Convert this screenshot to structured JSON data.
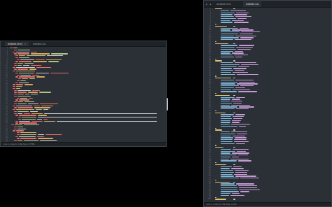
{
  "left_window": {
    "tabs": [
      {
        "label": "website.html",
        "active": true
      },
      {
        "label": "website.css",
        "active": false
      }
    ],
    "status_text": "Line 1, Column 1   Tab Size: 4   HTML",
    "code_color_keys": [
      "tag",
      "attr",
      "string",
      "text",
      "comment",
      "tag",
      "tag",
      "string",
      "text",
      "tag"
    ]
  },
  "right_window": {
    "tabs": [
      {
        "label": "website.html",
        "active": false
      },
      {
        "label": "website.css",
        "active": true
      }
    ],
    "status_text": "Line 1, Column 1   Tab Size: 4   CSS",
    "visible_snippets": [
      "body {",
      "font-family:",
      "background-color:",
      "color:",
      "width:",
      "height:",
      "margin:",
      "padding:"
    ]
  },
  "theme": {
    "tag": "#e86a6a",
    "attr": "#d7a65e",
    "string": "#a9c77e",
    "text": "#c9ced3",
    "comment": "#6c7580",
    "prop": "#7fb3d5",
    "value": "#c69ad6",
    "selector": "#e0c070"
  }
}
